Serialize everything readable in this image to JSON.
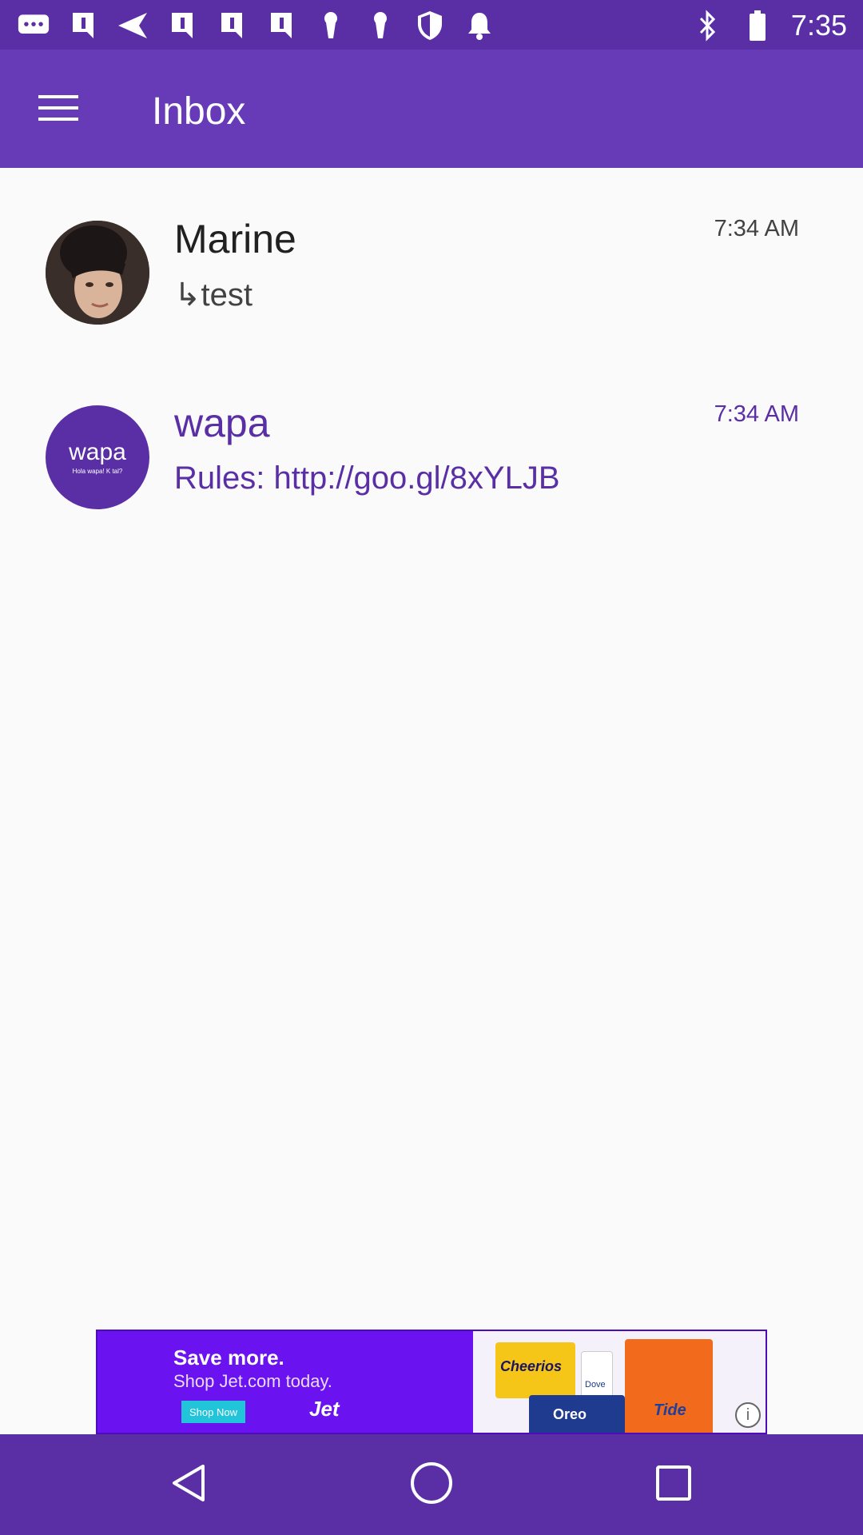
{
  "status_bar": {
    "time": "7:35",
    "left_icons": [
      "chat-bubble-icon",
      "bookmark-icon",
      "send-icon",
      "bookmark-icon",
      "bookmark-icon",
      "bookmark-icon",
      "keyhole-icon",
      "keyhole-icon",
      "shield-icon",
      "bell-icon"
    ],
    "right_icons": [
      "bluetooth-icon",
      "battery-icon"
    ]
  },
  "app_bar": {
    "title": "Inbox",
    "menu_icon": "hamburger-menu-icon"
  },
  "conversations": [
    {
      "name": "Marine",
      "snippet": "↳test",
      "time": "7:34 AM",
      "unread": false,
      "avatar": "photo"
    },
    {
      "name": "wapa",
      "snippet": "Rules: http://goo.gl/8xYLJB",
      "time": "7:34 AM",
      "unread": true,
      "avatar_text": "wapa",
      "avatar_tagline": "Hola wapa! K tal?"
    }
  ],
  "ad": {
    "headline": "Save more.",
    "subline": "Shop Jet.com today.",
    "cta": "Shop Now",
    "brand": "Jet",
    "product_1": "Cheerios",
    "product_2": "Tide",
    "product_3": "Oreo",
    "product_4": "Dove"
  },
  "nav_bar": {
    "back": "back-triangle-icon",
    "home": "home-circle-icon",
    "recents": "recents-square-icon"
  },
  "colors": {
    "status_bar": "#5a2fa6",
    "app_bar": "#673ab7",
    "accent": "#5a2fa6",
    "background": "#fafafa"
  }
}
